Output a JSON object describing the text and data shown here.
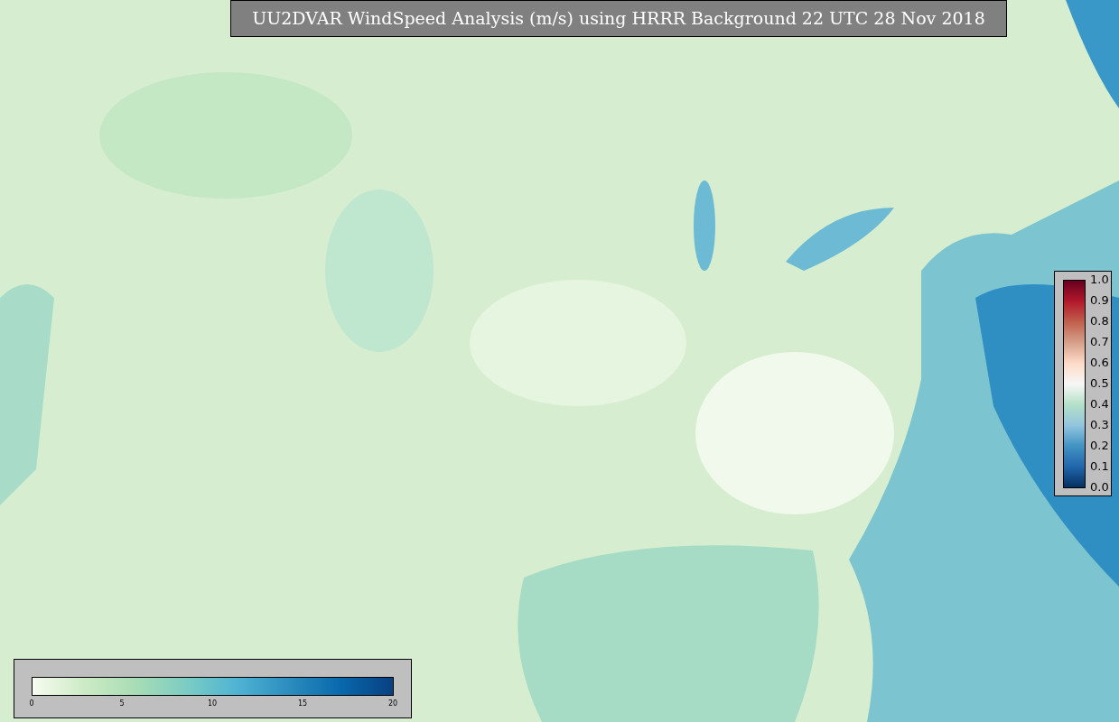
{
  "title": "UU2DVAR WindSpeed Analysis (m/s) using HRRR Background 22 UTC 28 Nov 2018",
  "ratio_colorbar": {
    "ticks": [
      "1.0",
      "0.9",
      "0.8",
      "0.7",
      "0.6",
      "0.5",
      "0.4",
      "0.3",
      "0.2",
      "0.1",
      "0.0"
    ]
  },
  "wind_colorbar": {
    "ticks": [
      "0",
      "5",
      "10",
      "15",
      "20"
    ]
  }
}
